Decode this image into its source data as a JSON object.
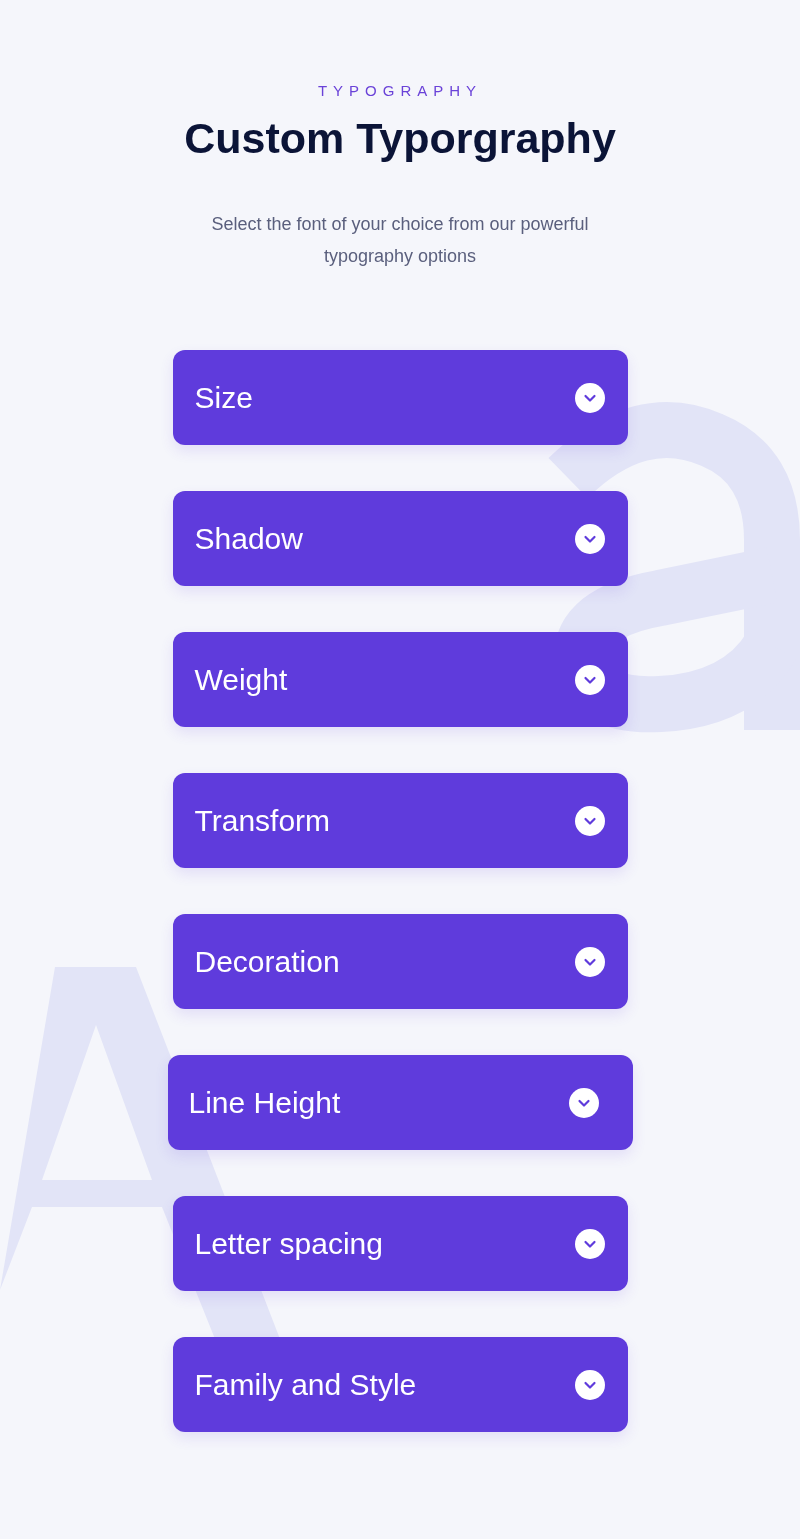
{
  "eyebrow": "TYPOGRAPHY",
  "title": "Custom Typorgraphy",
  "subtitle": "Select the font of your choice from our powerful typography options",
  "options": [
    {
      "label": "Size",
      "hovered": false
    },
    {
      "label": "Shadow",
      "hovered": false
    },
    {
      "label": "Weight",
      "hovered": false
    },
    {
      "label": "Transform",
      "hovered": false
    },
    {
      "label": "Decoration",
      "hovered": false
    },
    {
      "label": "Line Height",
      "hovered": true
    },
    {
      "label": "Letter spacing",
      "hovered": false
    },
    {
      "label": "Family and Style",
      "hovered": false
    }
  ]
}
